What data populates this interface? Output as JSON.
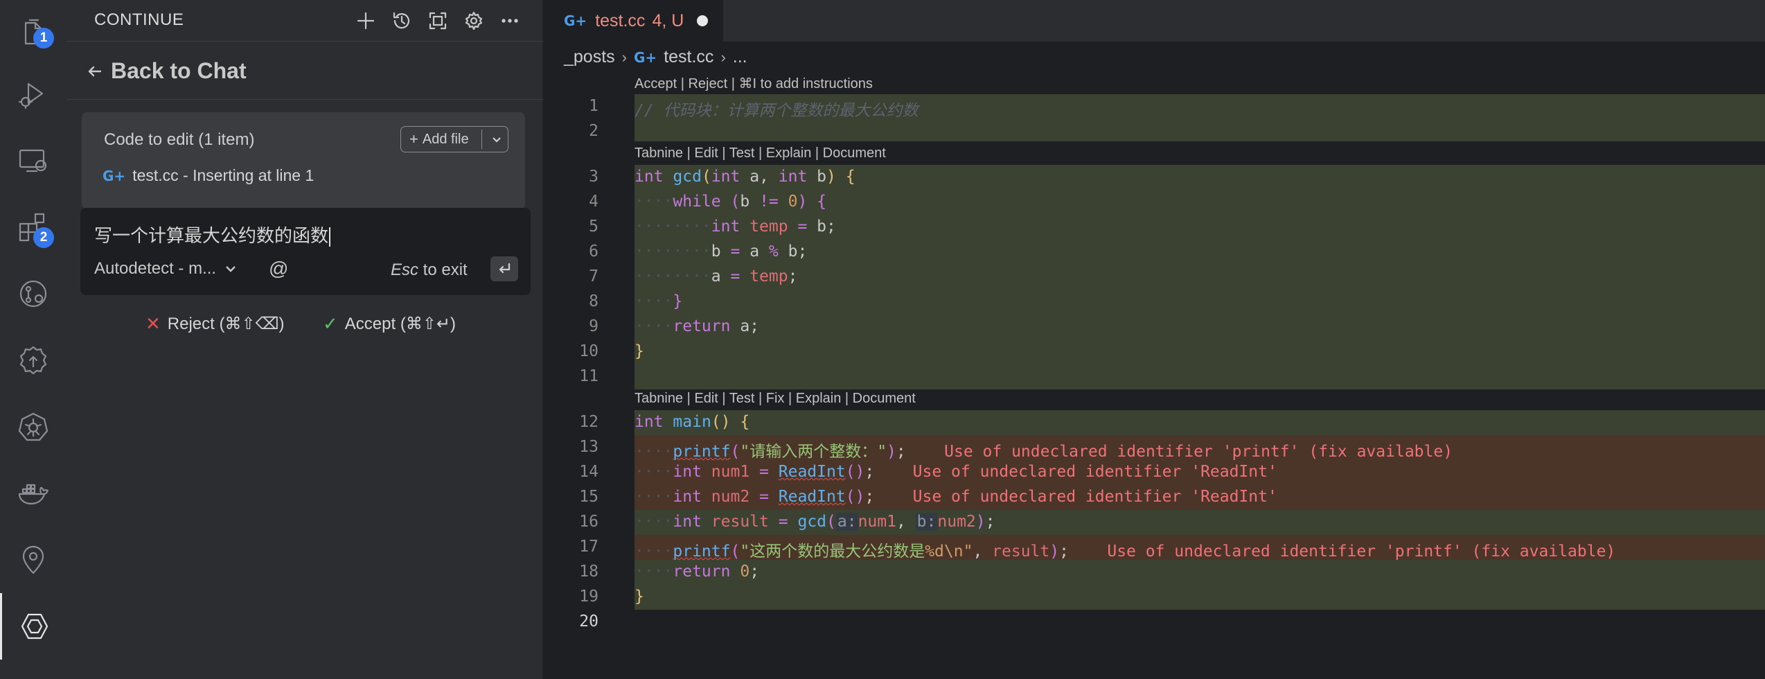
{
  "activity_bar": {
    "items": [
      {
        "name": "explorer-icon",
        "badge": "1"
      },
      {
        "name": "run-debug-icon",
        "badge": ""
      },
      {
        "name": "remote-explorer-icon",
        "badge": ""
      },
      {
        "name": "extensions-icon",
        "badge": "2"
      },
      {
        "name": "source-control-icon",
        "badge": ""
      },
      {
        "name": "settings-cloud-icon",
        "badge": ""
      },
      {
        "name": "kubernetes-icon",
        "badge": ""
      },
      {
        "name": "docker-icon",
        "badge": ""
      },
      {
        "name": "gitlens-icon",
        "badge": ""
      },
      {
        "name": "continue-icon",
        "badge": ""
      }
    ]
  },
  "side_panel": {
    "title": "CONTINUE",
    "header_icons": [
      "plus-icon",
      "history-icon",
      "fullscreen-icon",
      "gear-icon",
      "more-icon"
    ],
    "back_label": "Back to Chat",
    "code_to_edit": {
      "title": "Code to edit (1 item)",
      "add_file_label": "Add file",
      "item_label": "test.cc - Inserting at line 1"
    },
    "input": {
      "text": "写一个计算最大公约数的函数",
      "model": "Autodetect - m...",
      "at_symbol": "@",
      "esc_key": "Esc",
      "esc_suffix": " to exit"
    },
    "reject_label": "Reject (⌘⇧⌫)",
    "accept_label": "Accept (⌘⇧↵)"
  },
  "editor": {
    "tab": {
      "name": "test.cc",
      "status": "4, U"
    },
    "breadcrumb": {
      "folder": "_posts",
      "file": "test.cc",
      "ellipsis": "..."
    },
    "codelens_accept": "Accept | Reject | ⌘I to add instructions",
    "codelens_gcd": "Tabnine | Edit | Test | Explain | Document",
    "codelens_main": "Tabnine | Edit | Test | Fix | Explain | Document",
    "line_numbers": [
      "1",
      "2",
      "3",
      "4",
      "5",
      "6",
      "7",
      "8",
      "9",
      "10",
      "11",
      "12",
      "13",
      "14",
      "15",
      "16",
      "17",
      "18",
      "19",
      "20"
    ],
    "code": {
      "l1_comment": "// 代码块：计算两个整数的最大公约数",
      "l13_str": "\"请输入两个整数：\"",
      "l17_str": "\"这两个数的最大公约数是",
      "l17_fmt": "%d\\n\"",
      "hint_a": "a:",
      "hint_b": "b:"
    },
    "diagnostics": {
      "l13": "Use of undeclared identifier 'printf' (fix available)",
      "l14": "Use of undeclared identifier 'ReadInt'",
      "l15": "Use of undeclared identifier 'ReadInt'",
      "l17": "Use of undeclared identifier 'printf' (fix available)"
    }
  }
}
